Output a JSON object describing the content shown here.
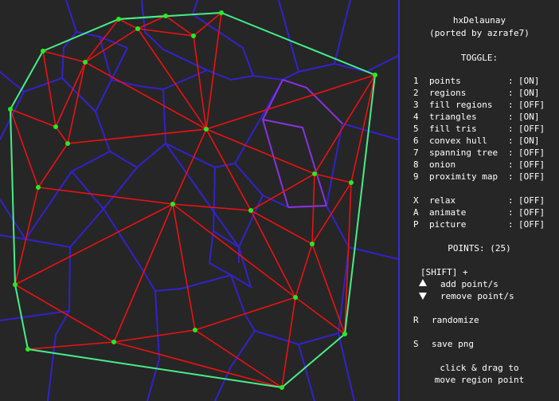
{
  "colors": {
    "background": "#262626",
    "voronoi": "#3322cc",
    "voronoi_highlight": "#8833dd",
    "triangles": "#ee1111",
    "hull": "#44ee88",
    "points": "#22ee22",
    "text": "#ffffff"
  },
  "panel": {
    "title": "hxDelaunay",
    "subtitle": "(ported by azrafe7)",
    "toggle_header": "TOGGLE:",
    "toggles": [
      {
        "key": "1",
        "label": "points",
        "value": "[ON]"
      },
      {
        "key": "2",
        "label": "regions",
        "value": "[ON]"
      },
      {
        "key": "3",
        "label": "fill regions",
        "value": "[OFF]"
      },
      {
        "key": "4",
        "label": "triangles",
        "value": "[ON]"
      },
      {
        "key": "5",
        "label": "fill tris",
        "value": "[OFF]"
      },
      {
        "key": "6",
        "label": "convex hull",
        "value": "[ON]"
      },
      {
        "key": "7",
        "label": "spanning tree",
        "value": "[OFF]"
      },
      {
        "key": "8",
        "label": "onion",
        "value": "[OFF]"
      },
      {
        "key": "9",
        "label": "proximity map",
        "value": "[OFF]"
      }
    ],
    "extras": [
      {
        "key": "X",
        "label": "relax",
        "value": "[OFF]"
      },
      {
        "key": "A",
        "label": "animate",
        "value": "[OFF]"
      },
      {
        "key": "P",
        "label": "picture",
        "value": "[OFF]"
      }
    ],
    "points_label": "POINTS: (25)",
    "shift_label": "[SHIFT] +",
    "add_label": "add point/s",
    "remove_label": "remove point/s",
    "randomize_key": "R",
    "randomize_label": "randomize",
    "save_key": "S",
    "save_label": "save png",
    "hint_line1": "click & drag to",
    "hint_line2": "move region point"
  }
}
